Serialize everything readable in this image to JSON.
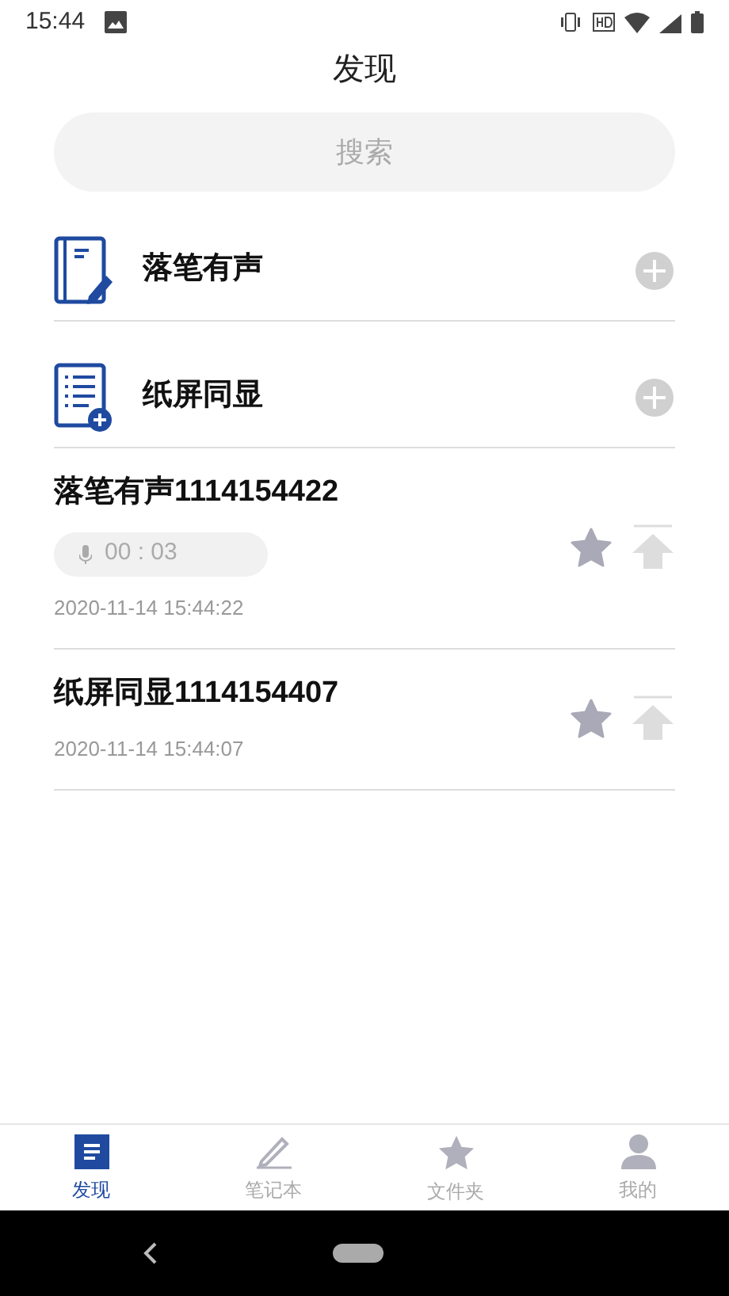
{
  "status_bar": {
    "time": "15:44"
  },
  "header": {
    "title": "发现"
  },
  "search": {
    "placeholder": "搜索"
  },
  "actions": [
    {
      "kind": "pen",
      "label": "落笔有声"
    },
    {
      "kind": "list",
      "label": "纸屏同显"
    }
  ],
  "notes": [
    {
      "title": "落笔有声1114154422",
      "audio": "00 : 03",
      "date": "2020-11-14 15:44:22"
    },
    {
      "title": "纸屏同显1114154407",
      "date": "2020-11-14 15:44:07"
    }
  ],
  "tabs": [
    {
      "kind": "discover",
      "label": "发现",
      "selected": true
    },
    {
      "kind": "notebook",
      "label": "笔记本",
      "selected": false
    },
    {
      "kind": "folder",
      "label": "文件夹",
      "selected": false
    },
    {
      "kind": "me",
      "label": "我的",
      "selected": false
    }
  ]
}
